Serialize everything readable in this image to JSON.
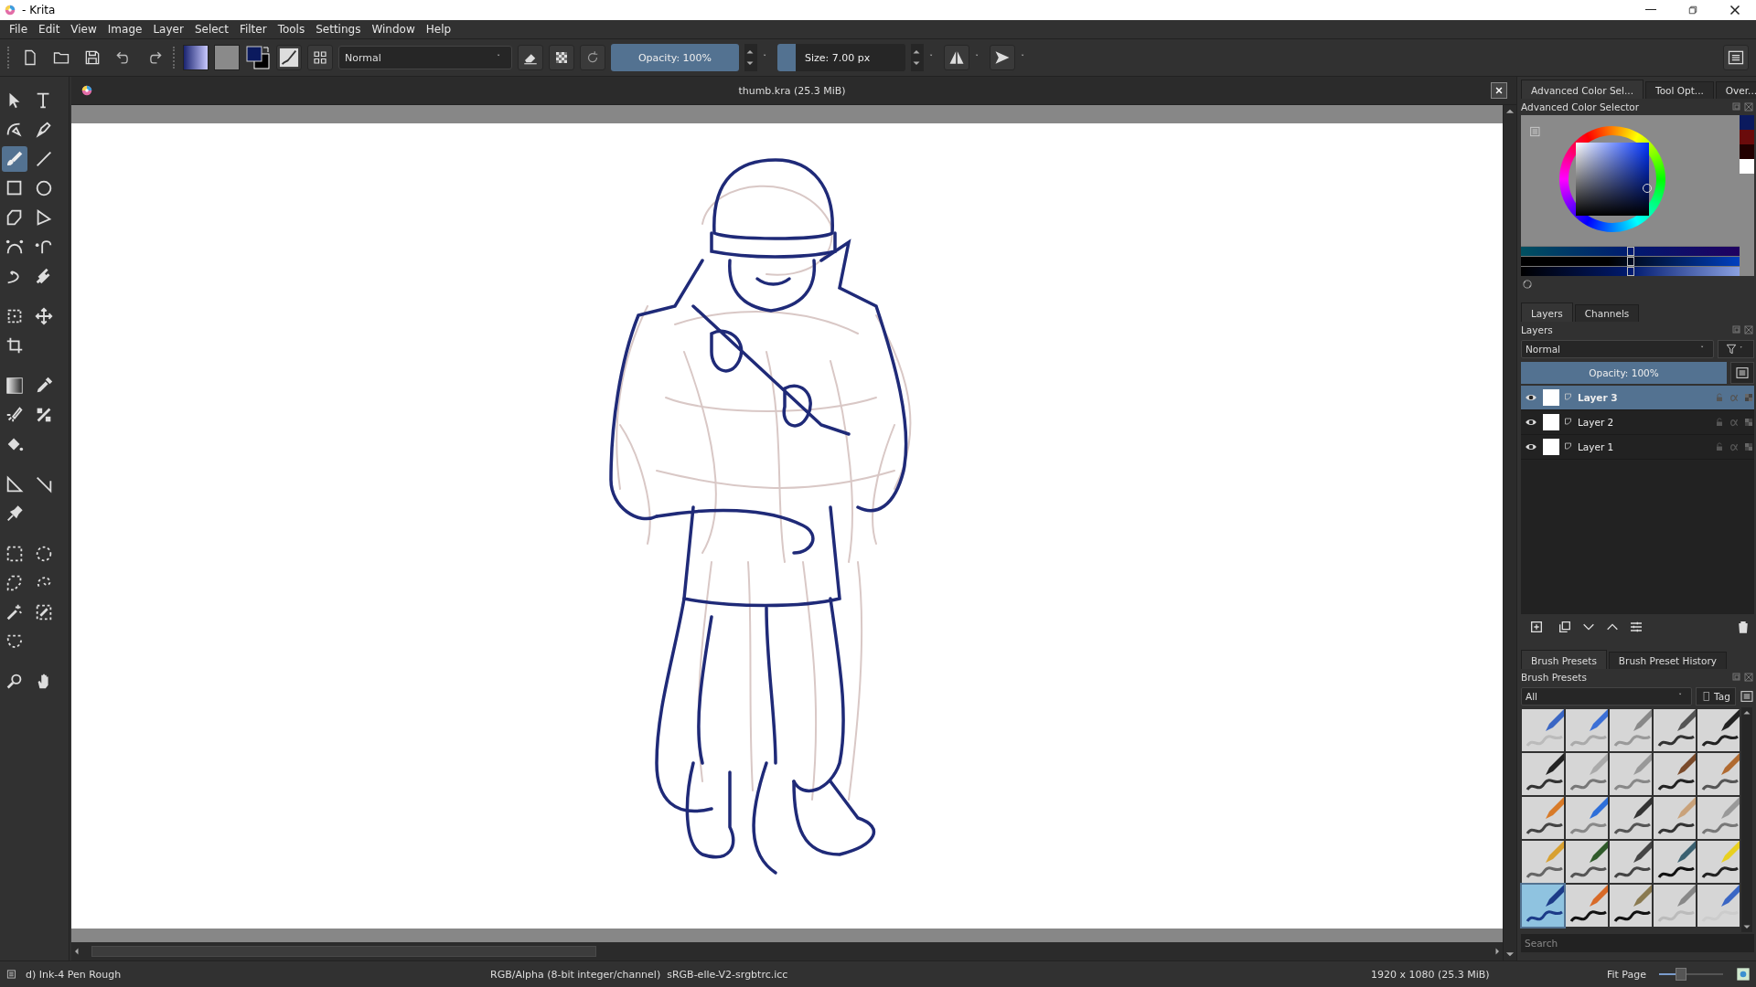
{
  "window": {
    "title": "- Krita"
  },
  "menu": [
    "File",
    "Edit",
    "View",
    "Image",
    "Layer",
    "Select",
    "Filter",
    "Tools",
    "Settings",
    "Window",
    "Help"
  ],
  "toolbar": {
    "blend_mode": "Normal",
    "opacity": {
      "label": "Opacity: 100%",
      "level": 1
    },
    "size": {
      "label": "Size: 7.00 px",
      "level": 0.14
    }
  },
  "tools": [
    {
      "selected": false
    },
    {
      "selected": false
    },
    {
      "selected": false
    },
    {
      "selected": false
    },
    {
      "selected": true
    },
    {
      "selected": false
    },
    {
      "selected": false
    },
    {
      "selected": false
    },
    {
      "selected": false
    },
    {
      "selected": false
    },
    {
      "selected": false
    },
    {
      "selected": false
    },
    {
      "selected": false
    },
    {
      "selected": false
    },
    {
      "selected": false
    },
    {
      "selected": false
    },
    {
      "selected": false
    },
    {
      "selected": false
    },
    {
      "selected": false
    },
    {
      "selected": false
    },
    {
      "selected": false
    },
    {
      "selected": false
    },
    {
      "selected": false
    },
    {
      "selected": false
    },
    {
      "selected": false
    },
    {
      "selected": false
    },
    {
      "selected": false
    },
    {
      "selected": false
    },
    {
      "selected": false
    },
    {
      "selected": false
    },
    {
      "selected": false
    },
    {
      "selected": false
    },
    {
      "selected": false
    },
    {
      "selected": false
    }
  ],
  "document": {
    "title": "thumb.kra (25.3 MiB)"
  },
  "color_docker": {
    "tabs": [
      {
        "label": "Advanced Color Sel...",
        "selected": true
      },
      {
        "label": "Tool Opt...",
        "selected": false
      },
      {
        "label": "Over...",
        "selected": false
      }
    ],
    "title": "Advanced Color Selector",
    "sliders": [
      {
        "level": 0.5
      },
      {
        "level": 0.5
      },
      {
        "level": 0.5
      }
    ]
  },
  "layers_docker": {
    "tabs": [
      {
        "label": "Layers",
        "selected": true
      },
      {
        "label": "Channels",
        "selected": false
      }
    ],
    "title": "Layers",
    "blend_mode": "Normal",
    "opacity": {
      "label": "Opacity: 100%",
      "level": 1
    },
    "layers": [
      {
        "name": "Layer 3",
        "visible": true,
        "selected": true
      },
      {
        "name": "Layer 2",
        "visible": true,
        "selected": false
      },
      {
        "name": "Layer 1",
        "visible": true,
        "selected": false
      }
    ]
  },
  "brush_docker": {
    "tabs": [
      {
        "label": "Brush Presets",
        "selected": true
      },
      {
        "label": "Brush Preset History",
        "selected": false
      }
    ],
    "title": "Brush Presets",
    "filter": "All",
    "tag": "Tag",
    "presets": [
      {
        "selected": false
      },
      {
        "selected": false
      },
      {
        "selected": false
      },
      {
        "selected": false
      },
      {
        "selected": false
      },
      {
        "selected": false
      },
      {
        "selected": false
      },
      {
        "selected": false
      },
      {
        "selected": false
      },
      {
        "selected": false
      },
      {
        "selected": false
      },
      {
        "selected": false
      },
      {
        "selected": false
      },
      {
        "selected": false
      },
      {
        "selected": false
      },
      {
        "selected": false
      },
      {
        "selected": false
      },
      {
        "selected": false
      },
      {
        "selected": false
      },
      {
        "selected": false
      },
      {
        "selected": true
      },
      {
        "selected": false
      },
      {
        "selected": false
      },
      {
        "selected": false
      },
      {
        "selected": false
      }
    ],
    "search": {
      "placeholder": "Search"
    }
  },
  "status_bar": {
    "brush": "d) Ink-4 Pen Rough",
    "color_space": "RGB/Alpha (8-bit integer/channel)  sRGB-elle-V2-srgbtrc.icc",
    "image_size": "1920 x 1080 (25.3 MiB)",
    "zoom": "Fit Page",
    "zoom_slider": {
      "level": 0.33
    }
  }
}
